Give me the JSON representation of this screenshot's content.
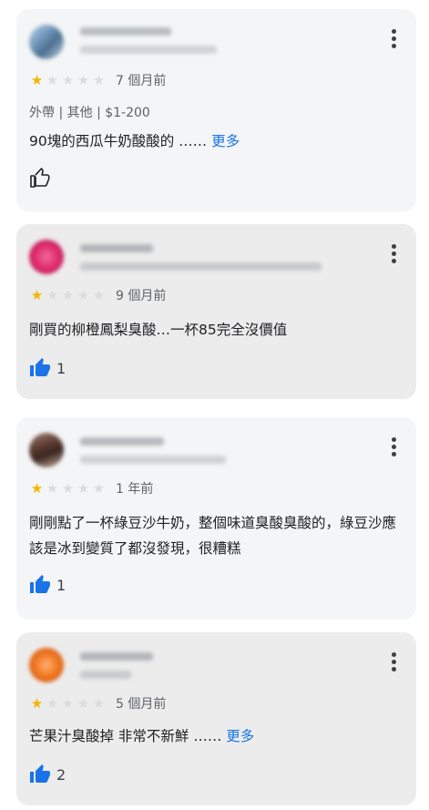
{
  "reviews": [
    {
      "time": "7 個月前",
      "meta": "外帶 | 其他 | $1-200",
      "text": "90塊的西瓜牛奶酸酸的 …… ",
      "more": "更多",
      "likes": "",
      "liked": false,
      "rating": 1
    },
    {
      "time": "9 個月前",
      "text": "剛買的柳橙鳳梨臭酸…一杯85完全沒價值",
      "likes": "1",
      "liked": true,
      "rating": 1
    },
    {
      "time": "1 年前",
      "text": "剛剛點了一杯綠豆沙牛奶，整個味道臭酸臭酸的，綠豆沙應該是冰到變質了都沒發現，很糟糕",
      "likes": "1",
      "liked": true,
      "rating": 1
    },
    {
      "time": "5 個月前",
      "text": "芒果汁臭酸掉 非常不新鮮 …… ",
      "more": "更多",
      "likes": "2",
      "liked": true,
      "rating": 1
    }
  ],
  "colors": {
    "star_on": "#f5b400",
    "star_off": "#dadce0",
    "link": "#1a73e8",
    "like_filled": "#1a73e8"
  },
  "icons": [
    "more-vert-icon",
    "star-icon",
    "thumb-up-outline-icon",
    "thumb-up-filled-icon"
  ]
}
